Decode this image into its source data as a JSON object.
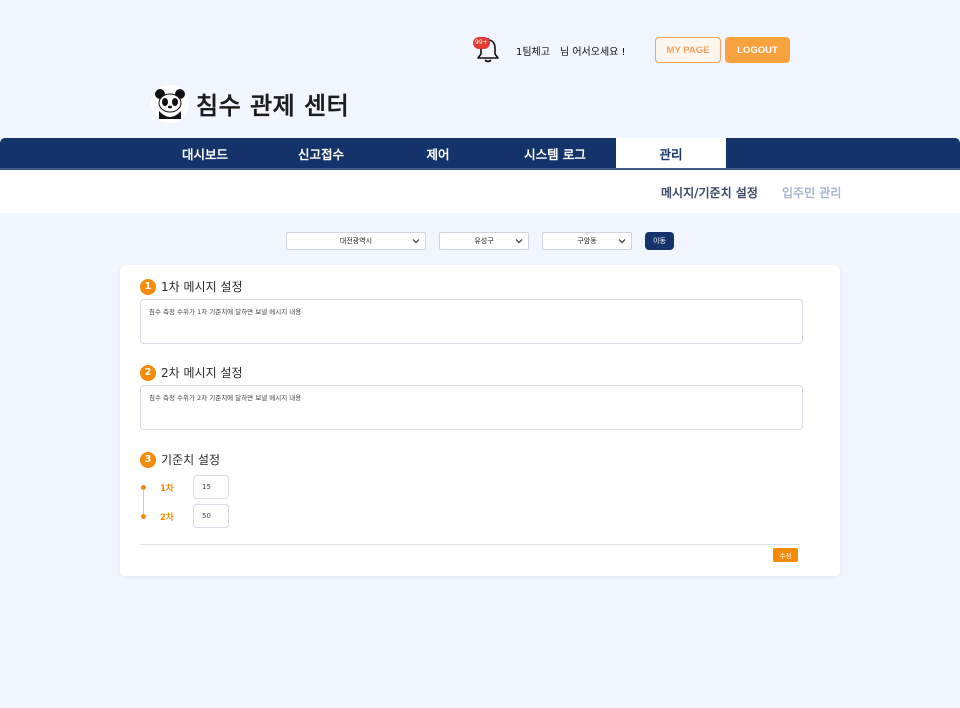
{
  "header": {
    "notification_count": "99+",
    "team_name": "1팀체고",
    "greeting": "님 어서오세요 !",
    "mypage_label": "MY PAGE",
    "logout_label": "LOGOUT"
  },
  "logo": {
    "icon": "panda-icon",
    "title": "침수 관제 센터"
  },
  "nav": {
    "items": [
      {
        "label": "대시보드"
      },
      {
        "label": "신고접수"
      },
      {
        "label": "제어"
      },
      {
        "label": "시스템 로그"
      },
      {
        "label": "관리"
      }
    ],
    "active": "관리"
  },
  "subnav": {
    "items": [
      {
        "label": "메시지/기준치 설정"
      },
      {
        "label": "입주민 관리"
      }
    ],
    "active": "메시지/기준치 설정"
  },
  "filters": {
    "city": "대전광역시",
    "district": "유성구",
    "dong": "구암동",
    "move_label": "이동"
  },
  "sections": {
    "first": {
      "number": "1",
      "title": "1차 메시지 설정",
      "message": "침수 측정 수위가 1차 기준치에 달하면 보낼 메시지 내용"
    },
    "second": {
      "number": "2",
      "title": "2차 메시지 설정",
      "message": "침수 측정 수위가 2차 기준치에 달하면 보낼 메시지 내용"
    },
    "threshold": {
      "number": "3",
      "title": "기준치 설정",
      "levels": [
        {
          "label": "1차",
          "value": "15"
        },
        {
          "label": "2차",
          "value": "50"
        }
      ]
    }
  },
  "edit_label": "수정",
  "colors": {
    "navy": "#14336b",
    "orange": "#f58a07",
    "background": "#f0f5fe"
  }
}
